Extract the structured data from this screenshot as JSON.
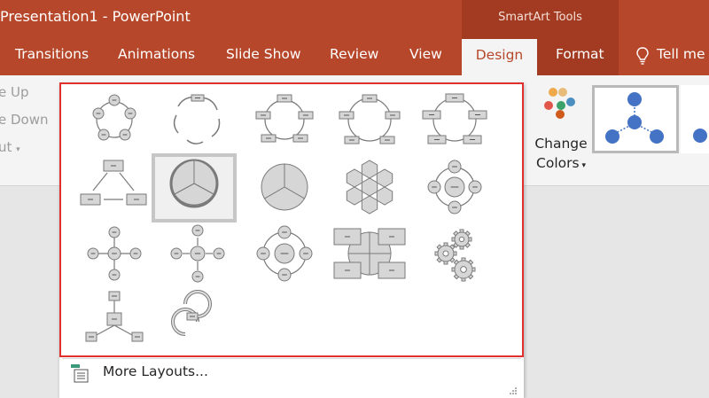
{
  "titlebar": {
    "title": "Presentation1  -  PowerPoint",
    "contextual_group": "SmartArt Tools",
    "accent": "#b7472a"
  },
  "tabs": {
    "transitions": "Transitions",
    "animations": "Animations",
    "slideshow": "Slide Show",
    "review": "Review",
    "view": "View",
    "design": "Design",
    "format": "Format",
    "tellme": "Tell me w"
  },
  "ribbon": {
    "move_up": "e Up",
    "move_down": "e Down",
    "layout": "ut",
    "change_colors_line1": "Change",
    "change_colors_line2": "Colors"
  },
  "gallery": {
    "more_layouts": "More Layouts...",
    "selected_index": 6,
    "highlight_color": "#e02f2f",
    "icons": [
      "basic-cycle-icon",
      "text-cycle-icon",
      "block-cycle-icon",
      "nondirectional-cycle-icon",
      "continuous-cycle-icon",
      "multidirectional-cycle-icon",
      "segmented-cycle-icon",
      "basic-pie-icon",
      "hexagon-radial-icon",
      "basic-radial-icon",
      "radial-list-icon",
      "diverging-radial-icon",
      "radial-cycle-icon",
      "cycle-matrix-icon",
      "gear-icon",
      "radial-cluster-icon",
      "circle-arrow-process-icon"
    ]
  }
}
